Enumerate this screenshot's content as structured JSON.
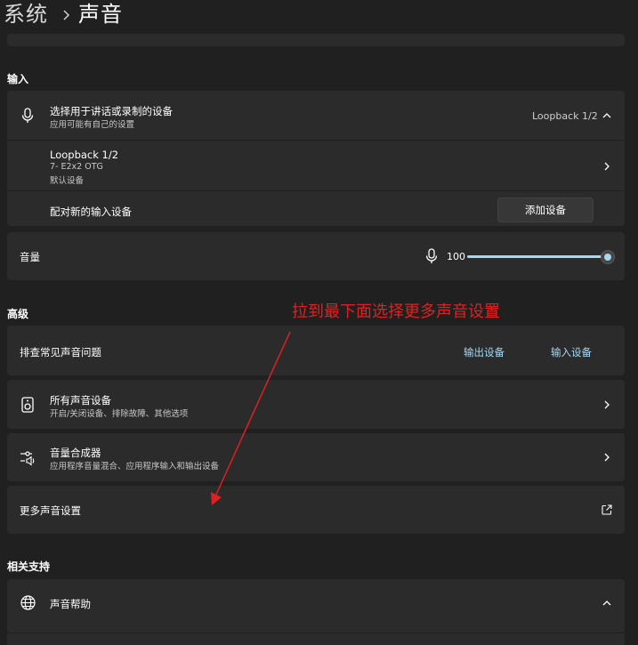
{
  "breadcrumb": {
    "parent": "系统",
    "current": "声音"
  },
  "input_section": {
    "heading": "输入",
    "device_select": {
      "title": "选择用于讲话或录制的设备",
      "subtitle": "应用可能有自己的设置",
      "value": "Loopback 1/2"
    },
    "device": {
      "name": "Loopback 1/2",
      "model": "7- E2x2 OTG",
      "status": "默认设备"
    },
    "pair": {
      "label": "配对新的输入设备",
      "button": "添加设备"
    },
    "volume": {
      "label": "音量",
      "value": "100",
      "level": 1.0
    }
  },
  "advanced_section": {
    "heading": "高级",
    "troubleshoot": {
      "label": "排查常见声音问题",
      "output_link": "输出设备",
      "input_link": "输入设备"
    },
    "all_devices": {
      "title": "所有声音设备",
      "subtitle": "开启/关闭设备、排除故障、其他选项"
    },
    "mixer": {
      "title": "音量合成器",
      "subtitle": "应用程序音量混合、应用程序输入和输出设备"
    },
    "more_settings": {
      "label": "更多声音设置"
    }
  },
  "support_section": {
    "heading": "相关支持",
    "help": {
      "label": "声音帮助"
    }
  },
  "annotation": {
    "text": "拉到最下面选择更多声音设置",
    "color": "#e02020"
  },
  "colors": {
    "background": "#202020",
    "card": "#2b2b2b",
    "accent": "#a6d8f0",
    "annotation": "#e02020"
  }
}
